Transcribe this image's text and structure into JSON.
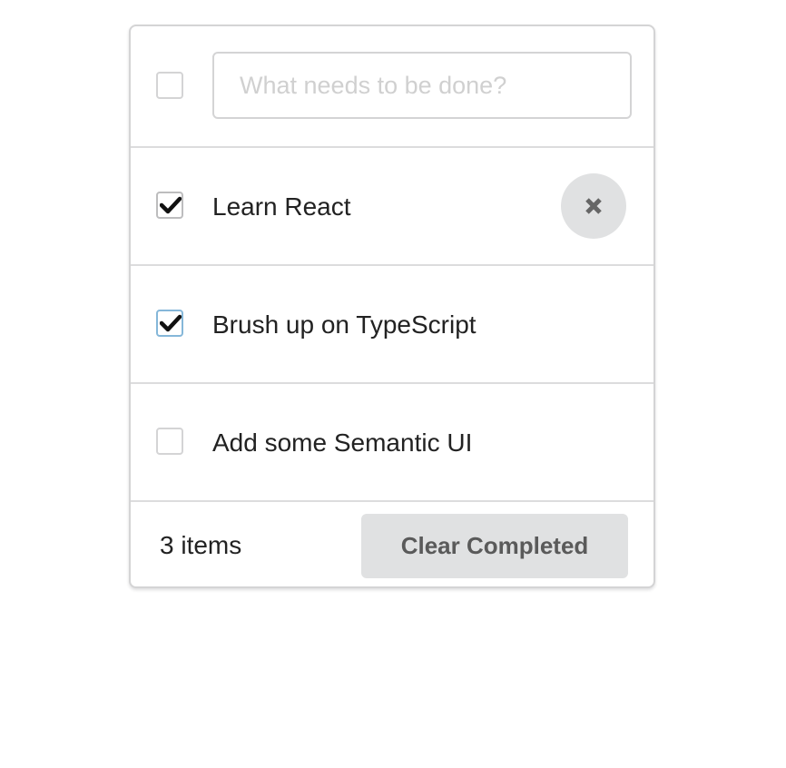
{
  "new_todo": {
    "placeholder": "What needs to be done?",
    "value": ""
  },
  "todos": [
    {
      "label": "Learn React",
      "completed": true
    },
    {
      "label": "Brush up on TypeScript",
      "completed": true
    },
    {
      "label": "Add some Semantic UI",
      "completed": false
    }
  ],
  "footer": {
    "count_label": "3 items",
    "clear_label": "Clear Completed"
  },
  "icons": {
    "check": "check-icon",
    "delete": "close-icon"
  }
}
